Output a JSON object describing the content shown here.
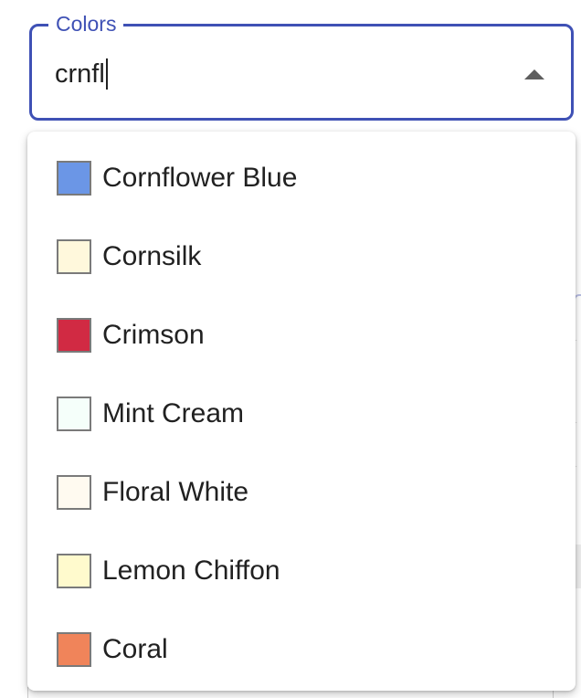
{
  "field": {
    "label": "Colors",
    "value": "crnfl",
    "accent_color": "#3f51b5",
    "indicator_icon": "triangle-up-icon"
  },
  "options": [
    {
      "label": "Cornflower Blue",
      "color": "#6b96e6"
    },
    {
      "label": "Cornsilk",
      "color": "#fff8dc"
    },
    {
      "label": "Crimson",
      "color": "#d12a43"
    },
    {
      "label": "Mint Cream",
      "color": "#f5fffa"
    },
    {
      "label": "Floral White",
      "color": "#fffaf0"
    },
    {
      "label": "Lemon Chiffon",
      "color": "#fffacd"
    },
    {
      "label": "Coral",
      "color": "#f0845a"
    }
  ]
}
